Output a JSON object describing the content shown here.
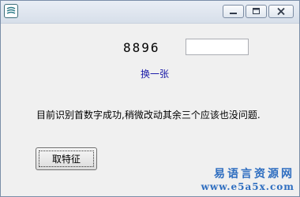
{
  "window": {
    "title": "",
    "controls": {
      "minimize_icon": "minimize-icon",
      "maximize_icon": "maximize-icon",
      "close_icon": "close-icon"
    }
  },
  "captcha": {
    "code": "8896"
  },
  "code_input": {
    "value": "",
    "placeholder": ""
  },
  "swap_link": "换一张",
  "status_message": "目前识别首数字成功,稍微改动其余三个应该也没问题.",
  "extract_button": "取特征",
  "watermark": {
    "title": "易语言资源网",
    "url": "www.e5a5x.com"
  },
  "colors": {
    "link": "#1a1aa8",
    "watermark": "#2f6ec0"
  }
}
